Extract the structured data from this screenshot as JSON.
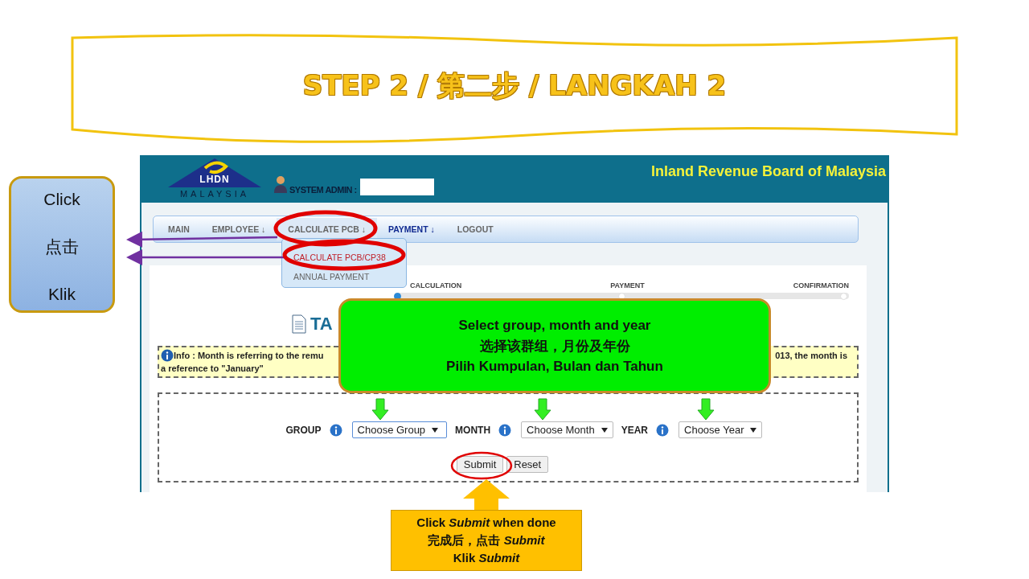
{
  "slide_title": "STEP 2 / 第二步 / LANGKAH 2",
  "app": {
    "logo": {
      "abbr": "LHDN",
      "country": "MALAYSIA"
    },
    "user_label": "SYSTEM ADMIN :",
    "org_name": "Inland Revenue Board of Malaysia",
    "nav": [
      {
        "label": "MAIN",
        "selected": false,
        "highlighted": false
      },
      {
        "label": "EMPLOYEE",
        "caret": "↓",
        "selected": false,
        "highlighted": false
      },
      {
        "label": "CALCULATE PCB",
        "caret": "↓",
        "selected": true,
        "highlighted": false
      },
      {
        "label": "PAYMENT",
        "caret": "↓",
        "selected": false,
        "highlighted": true
      },
      {
        "label": "LOGOUT",
        "selected": false,
        "highlighted": false
      }
    ],
    "menu": [
      {
        "label": "CALCULATE PCB/CP38",
        "selected": true
      },
      {
        "label": "ANNUAL PAYMENT",
        "selected": false
      }
    ],
    "steps": [
      {
        "label": "CALCULATION",
        "selected": true
      },
      {
        "label": "PAYMENT",
        "selected": false
      },
      {
        "label": "CONFIRMATION",
        "selected": false
      }
    ],
    "heading": "TA",
    "info": {
      "line_start": "Info : Month is referring to the remu",
      "line_end": "013, the month is",
      "line_2": "a reference to \"January\""
    },
    "fields": [
      {
        "label": "GROUP",
        "value": "Choose Group",
        "focused": true
      },
      {
        "label": "MONTH",
        "value": "Choose Month",
        "focused": false
      },
      {
        "label": "YEAR",
        "value": "Choose Year",
        "focused": false
      }
    ],
    "buttons": [
      "Submit",
      "Reset"
    ]
  },
  "callouts": {
    "click": [
      "Click",
      "点击",
      "Klik"
    ],
    "select": [
      "Select group, month and year",
      "选择该群组，月份及年份",
      "Pilih Kumpulan,  Bulan dan Tahun"
    ],
    "submit": [
      "Click *Submit* when done",
      "完成后，点击 *Submit*",
      "Klik *Submit*"
    ]
  }
}
